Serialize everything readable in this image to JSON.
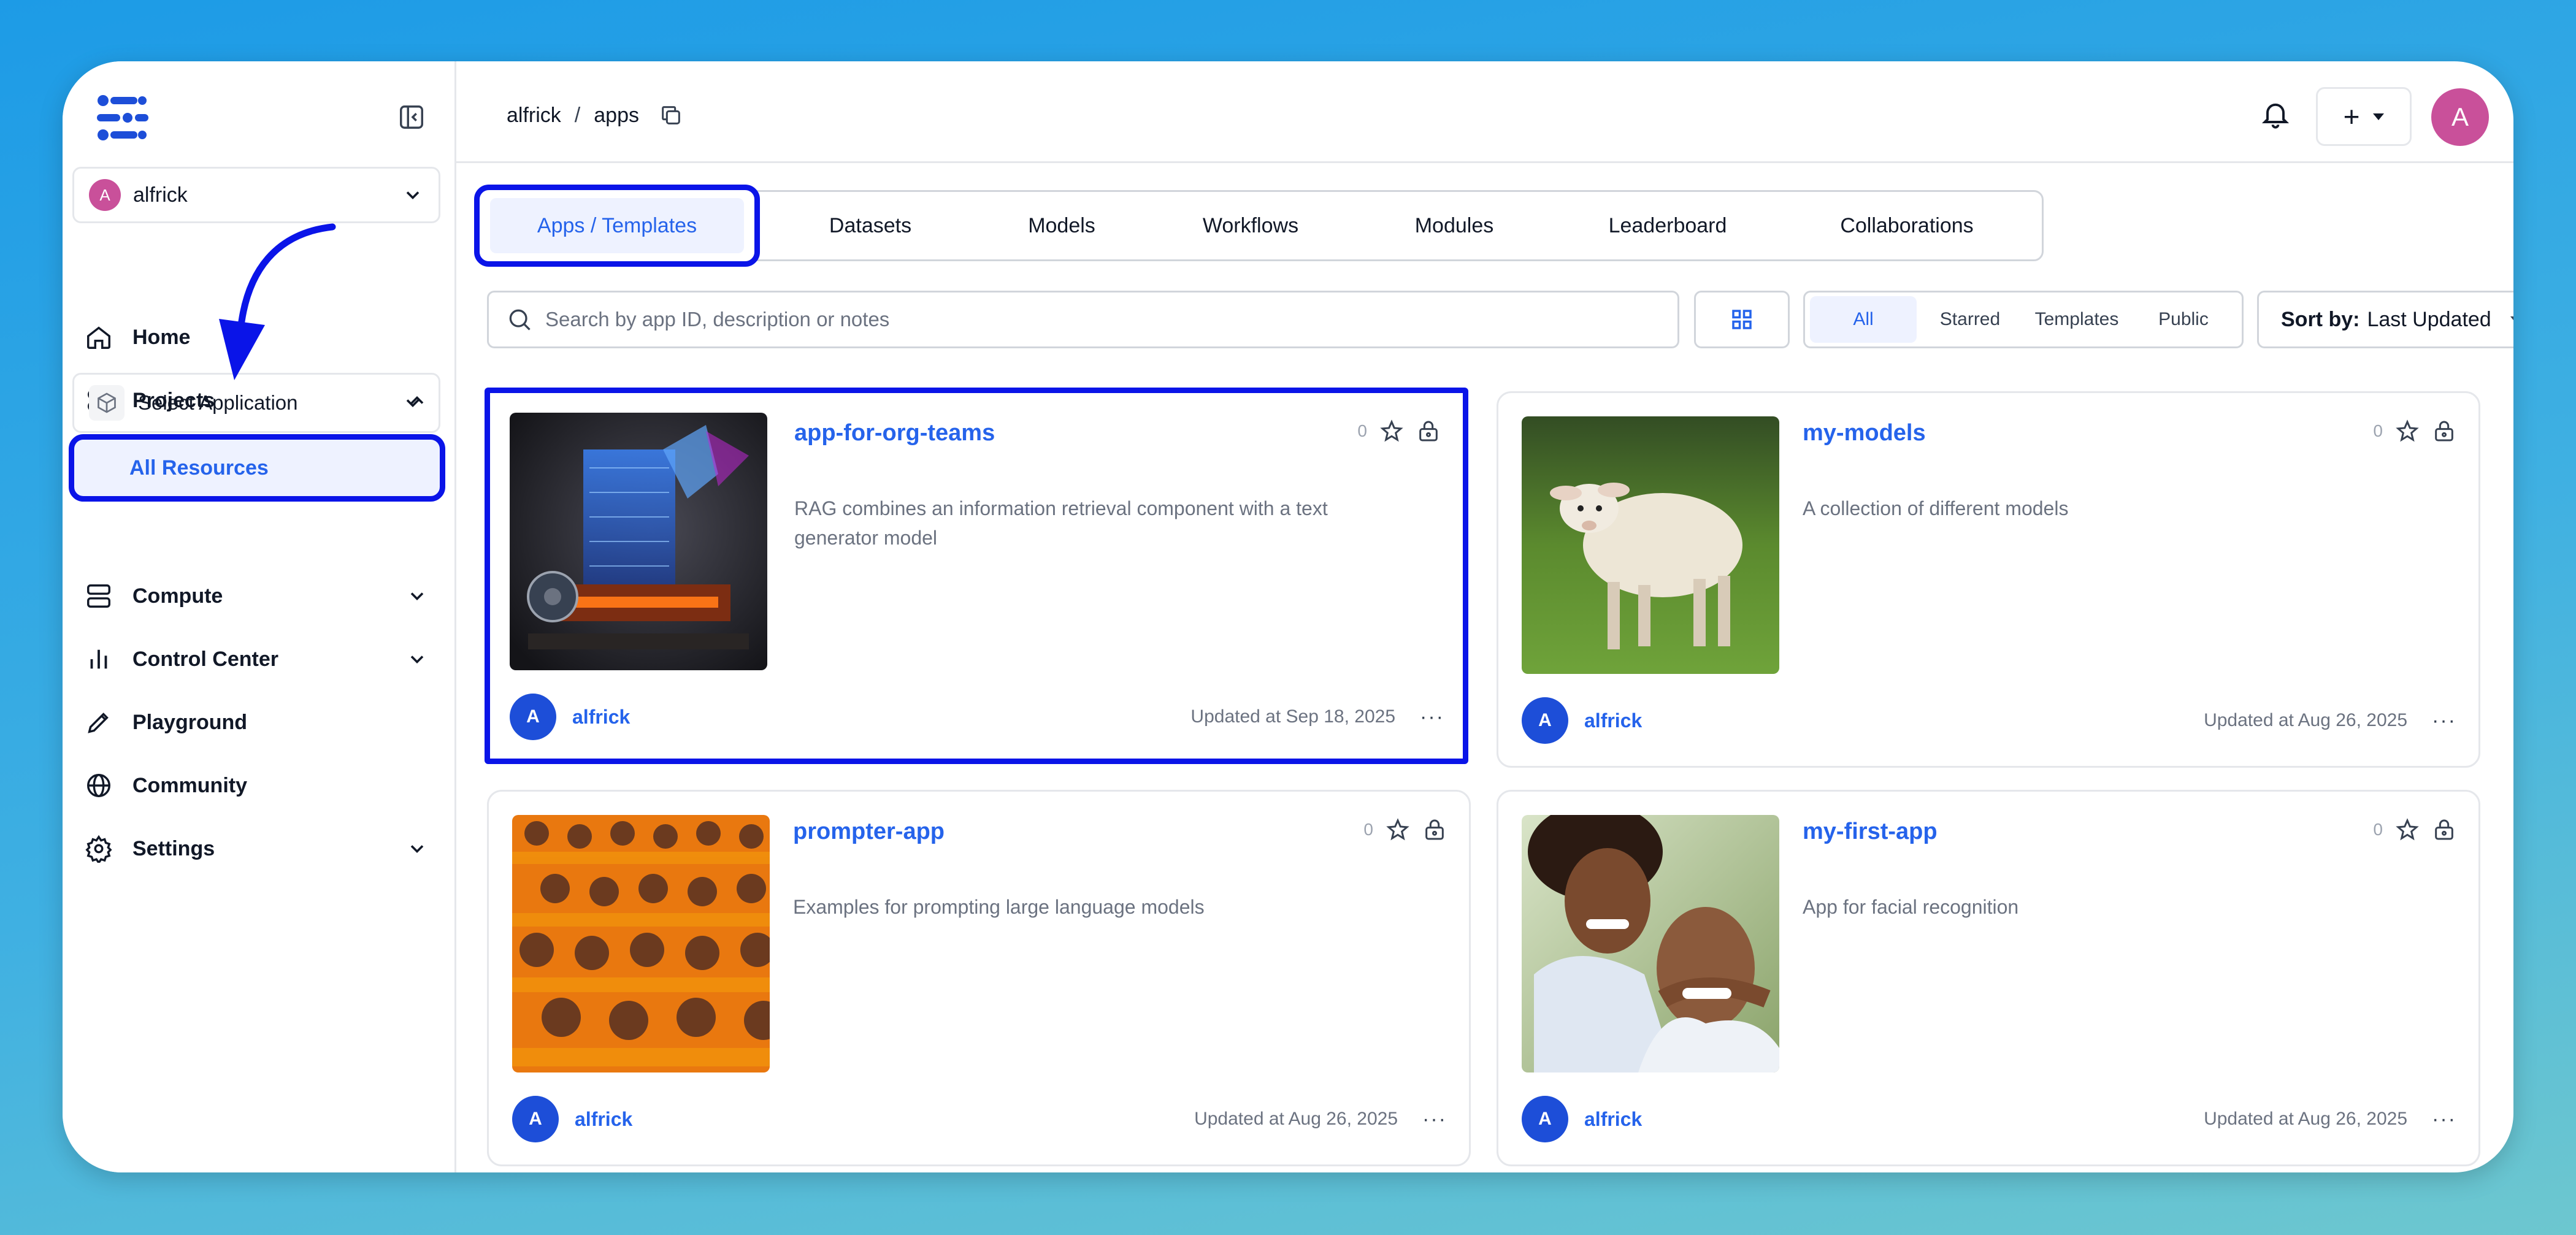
{
  "sidebar": {
    "org": {
      "avatar_letter": "A",
      "name": "alfrick"
    },
    "nav": {
      "home": "Home",
      "projects": "Projects",
      "select_application": "Select Application",
      "all_resources": "All Resources",
      "compute": "Compute",
      "control_center": "Control Center",
      "playground": "Playground",
      "community": "Community",
      "settings": "Settings"
    }
  },
  "header": {
    "breadcrumb": [
      "alfrick",
      "apps"
    ],
    "breadcrumb_sep": "/",
    "plus_label": "+",
    "user_avatar": "A"
  },
  "tabs": [
    "Apps / Templates",
    "Datasets",
    "Models",
    "Workflows",
    "Modules",
    "Leaderboard",
    "Collaborations"
  ],
  "search": {
    "placeholder": "Search by app ID, description or notes"
  },
  "filters": [
    "All",
    "Starred",
    "Templates",
    "Public"
  ],
  "sort": {
    "label": "Sort by:",
    "value": "Last Updated"
  },
  "cards": [
    {
      "title": "app-for-org-teams",
      "description": "RAG combines an information retrieval component with a text generator model",
      "stars": "0",
      "owner_letter": "A",
      "owner": "alfrick",
      "updated": "Updated at Sep 18, 2025",
      "more": "···"
    },
    {
      "title": "my-models",
      "description": "A collection of different models",
      "stars": "0",
      "owner_letter": "A",
      "owner": "alfrick",
      "updated": "Updated at Aug 26, 2025",
      "more": "···"
    },
    {
      "title": "prompter-app",
      "description": "Examples for prompting large language models",
      "stars": "0",
      "owner_letter": "A",
      "owner": "alfrick",
      "updated": "Updated at Aug 26, 2025",
      "more": "···"
    },
    {
      "title": "my-first-app",
      "description": "App for facial recognition",
      "stars": "0",
      "owner_letter": "A",
      "owner": "alfrick",
      "updated": "Updated at Aug 26, 2025",
      "more": "···"
    }
  ],
  "colors": {
    "accent": "#2563eb",
    "highlight": "#0a14e8",
    "avatar_pink": "#c9509a"
  }
}
